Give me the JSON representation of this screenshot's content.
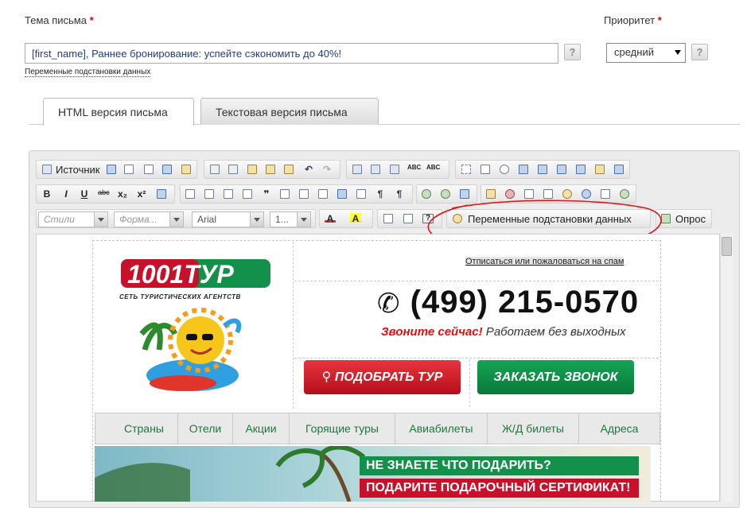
{
  "subject": {
    "label": "Тема письма",
    "required_mark": "*",
    "value": "[first_name], Раннее бронирование: успейте сэкономить до 40%!",
    "help": "?",
    "vars_link": "Переменные подстановки данных"
  },
  "priority": {
    "label": "Приоритет",
    "required_mark": "*",
    "selected": "средний",
    "help": "?"
  },
  "tabs": [
    {
      "label": "HTML версия письма"
    },
    {
      "label": "Текстовая версия письма"
    }
  ],
  "toolbar": {
    "source_label": "Источник",
    "styles_placeholder": "Стили",
    "format_placeholder": "Форма...",
    "font_value": "Arial",
    "size_value": "1...",
    "vars_button": "Переменные подстановки данных",
    "poll_button": "Опрос",
    "bold": "B",
    "italic": "I",
    "underline": "U",
    "strike": "abc",
    "sub": "x₂",
    "sup": "x²"
  },
  "email": {
    "unsubscribe": "Отписаться или пожаловаться на спам",
    "logo_text": "1001ТУР",
    "logo_tagline": "СЕТЬ ТУРИСТИЧЕСКИХ АГЕНТСТВ",
    "phone": "(499) 215-0570",
    "call_now": "Звоните сейчас!",
    "call_rest": " Работаем без выходных",
    "btn_find": "ПОДОБРАТЬ ТУР",
    "btn_callback": "ЗАКАЗАТЬ ЗВОНОК",
    "nav": [
      "Страны",
      "Отели",
      "Акции",
      "Горящие туры",
      "Авиабилеты",
      "Ж/Д билеты",
      "Адреса"
    ],
    "banner_line1": "НЕ ЗНАЕТЕ ЧТО ПОДАРИТЬ?",
    "banner_line2": "ПОДАРИТЕ ПОДАРОЧНЫЙ СЕРТИФИКАТ!"
  },
  "colors": {
    "accent_red": "#d11",
    "brand_green": "#13914a"
  }
}
